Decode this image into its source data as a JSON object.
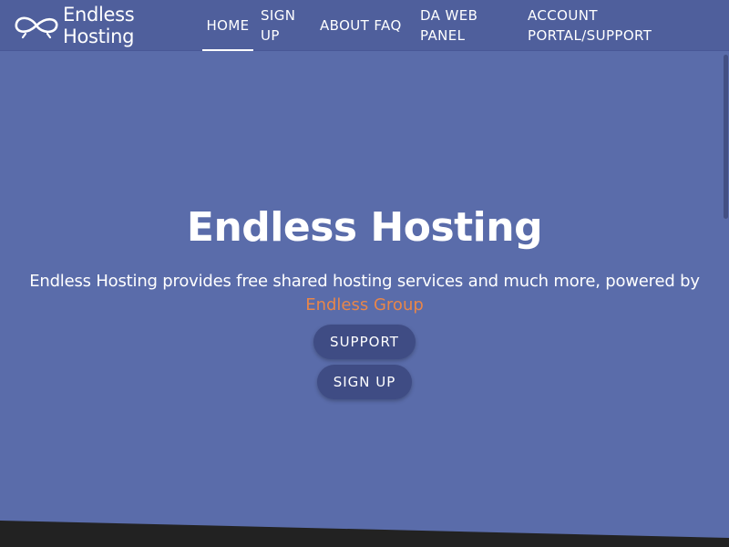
{
  "brand": {
    "name_line1": "Endless",
    "name_line2": "Hosting",
    "logo_icon": "infinity-icon"
  },
  "nav": {
    "home": "HOME",
    "signup_line1": "SIGN",
    "signup_line2": "UP",
    "about": "ABOUT FAQ",
    "da_line1": "DA WEB",
    "da_line2": "PANEL",
    "account_line1": "ACCOUNT",
    "account_line2": "PORTAL/SUPPORT"
  },
  "hero": {
    "title": "Endless Hosting",
    "description": "Endless Hosting provides free shared hosting services and much more, powered by",
    "link_text": "Endless Group",
    "support_button": "SUPPORT",
    "signup_button": "SIGN UP"
  },
  "colors": {
    "background": "#5a6caa",
    "navbar": "#4f5f9c",
    "button": "#3f4c84",
    "link": "#e8864a",
    "footer_strip": "#222222"
  }
}
